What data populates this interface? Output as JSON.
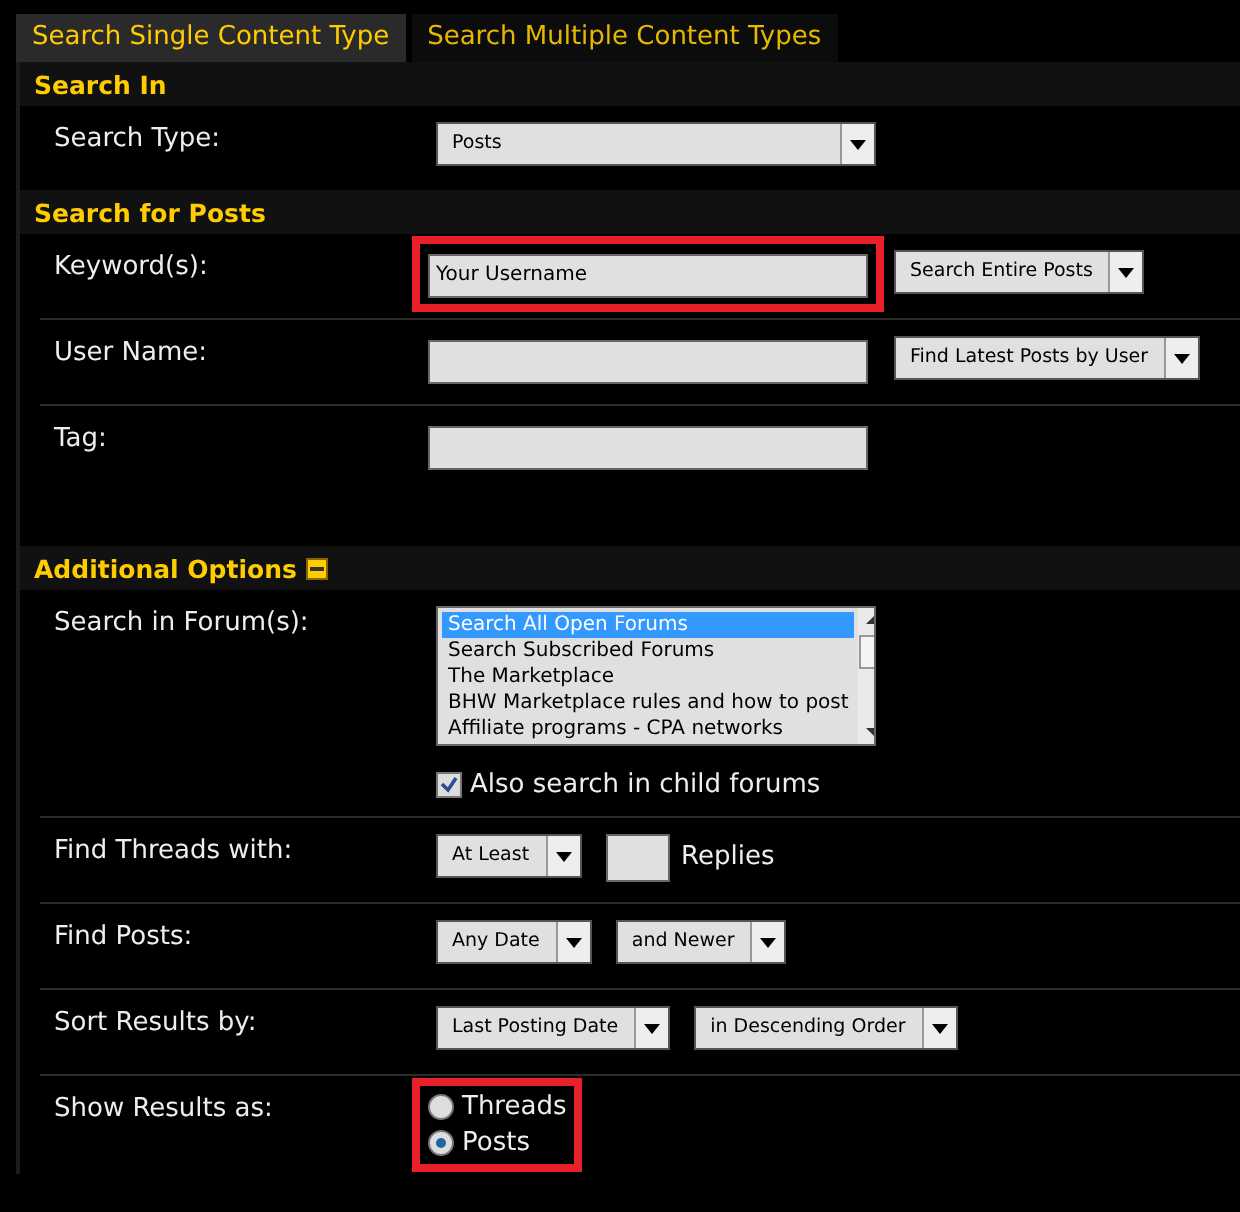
{
  "tabs": [
    {
      "label": "Search Single Content Type",
      "selected": true
    },
    {
      "label": "Search Multiple Content Types",
      "selected": false
    }
  ],
  "sections": [
    {
      "title": "Search In",
      "collapsible": false,
      "rows": [
        {
          "label": "Search Type:",
          "controls": [
            {
              "kind": "select",
              "value": "Posts",
              "wide": true
            }
          ]
        }
      ]
    },
    {
      "title": "Search for Posts",
      "collapsible": false,
      "rows": [
        {
          "label": "Keyword(s):",
          "controls": [
            {
              "kind": "text",
              "value": "Your Username",
              "highlighted": true
            },
            {
              "kind": "select",
              "value": "Search Entire Posts"
            }
          ]
        },
        {
          "label": "User Name:",
          "controls": [
            {
              "kind": "text"
            },
            {
              "kind": "select",
              "value": "Find Latest Posts by User"
            }
          ]
        },
        {
          "label": "Tag:",
          "controls": [
            {
              "kind": "text"
            }
          ]
        }
      ]
    },
    {
      "title": "Additional Options",
      "collapsible": true,
      "rows": [
        {
          "label": "Search in Forum(s):",
          "controls": [
            {
              "kind": "listbox",
              "items": [
                {
                  "label": "Search All Open Forums",
                  "selected": true
                },
                {
                  "label": "Search Subscribed Forums",
                  "selected": false
                },
                {
                  "label": "The Marketplace",
                  "selected": false
                },
                {
                  "label": "BHW Marketplace rules and how to post",
                  "selected": false
                },
                {
                  "label": "Affiliate programs - CPA networks",
                  "selected": false
                }
              ]
            },
            {
              "kind": "checkbox",
              "label": "Also search in child forums",
              "checked": true
            }
          ]
        },
        {
          "label": "Find Threads with:",
          "controls": [
            {
              "kind": "select",
              "value": "At Least"
            },
            {
              "kind": "number",
              "suffix": "Replies"
            }
          ]
        },
        {
          "label": "Find Posts:",
          "controls": [
            {
              "kind": "select",
              "value": "Any Date"
            },
            {
              "kind": "select",
              "value": "and Newer"
            }
          ]
        },
        {
          "label": "Sort Results by:",
          "controls": [
            {
              "kind": "select",
              "value": "Last Posting Date"
            },
            {
              "kind": "select",
              "value": "in Descending Order"
            }
          ]
        },
        {
          "label": "Show Results as:",
          "controls": [
            {
              "kind": "radios",
              "highlighted": true,
              "options": [
                {
                  "label": "Threads",
                  "selected": false
                },
                {
                  "label": "Posts",
                  "selected": true
                }
              ]
            }
          ]
        }
      ]
    }
  ]
}
